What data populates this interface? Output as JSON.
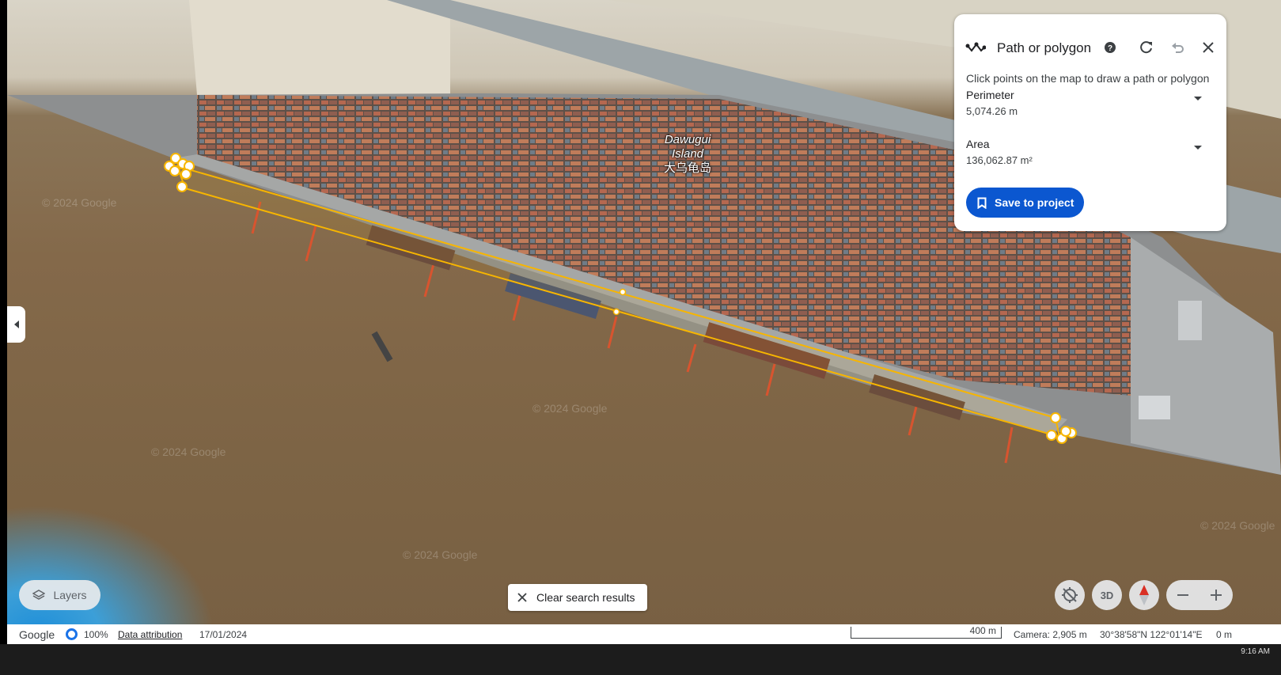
{
  "map": {
    "island_label_en": "Dawugui Island",
    "island_label_zh": "大乌龟岛",
    "watermark": "© 2024 Google"
  },
  "panel": {
    "title": "Path or polygon",
    "description": "Click points on the map to draw a path or polygon",
    "perimeter_label": "Perimeter",
    "perimeter_value": "5,074.26 m",
    "area_label": "Area",
    "area_value": "136,062.87 m²",
    "save_label": "Save to project",
    "icons": [
      "path-icon",
      "help-icon",
      "redo-icon",
      "undo-icon",
      "close-icon"
    ]
  },
  "controls": {
    "layers_label": "Layers",
    "clear_label": "Clear search results",
    "view3d_label": "3D",
    "zoom_out": "−",
    "zoom_in": "+"
  },
  "status": {
    "brand": "Google",
    "load_percent": "100%",
    "attribution": "Data attribution",
    "date": "17/01/2024",
    "scale": "400 m",
    "camera": "Camera: 2,905 m",
    "coords": "30°38'58\"N 122°01'14\"E",
    "elevation": "0 m"
  },
  "taskbar": {
    "clock": "9:16 AM"
  },
  "colors": {
    "accent": "#0b57d0",
    "path": "#f7b500",
    "compass_red": "#d93025"
  }
}
